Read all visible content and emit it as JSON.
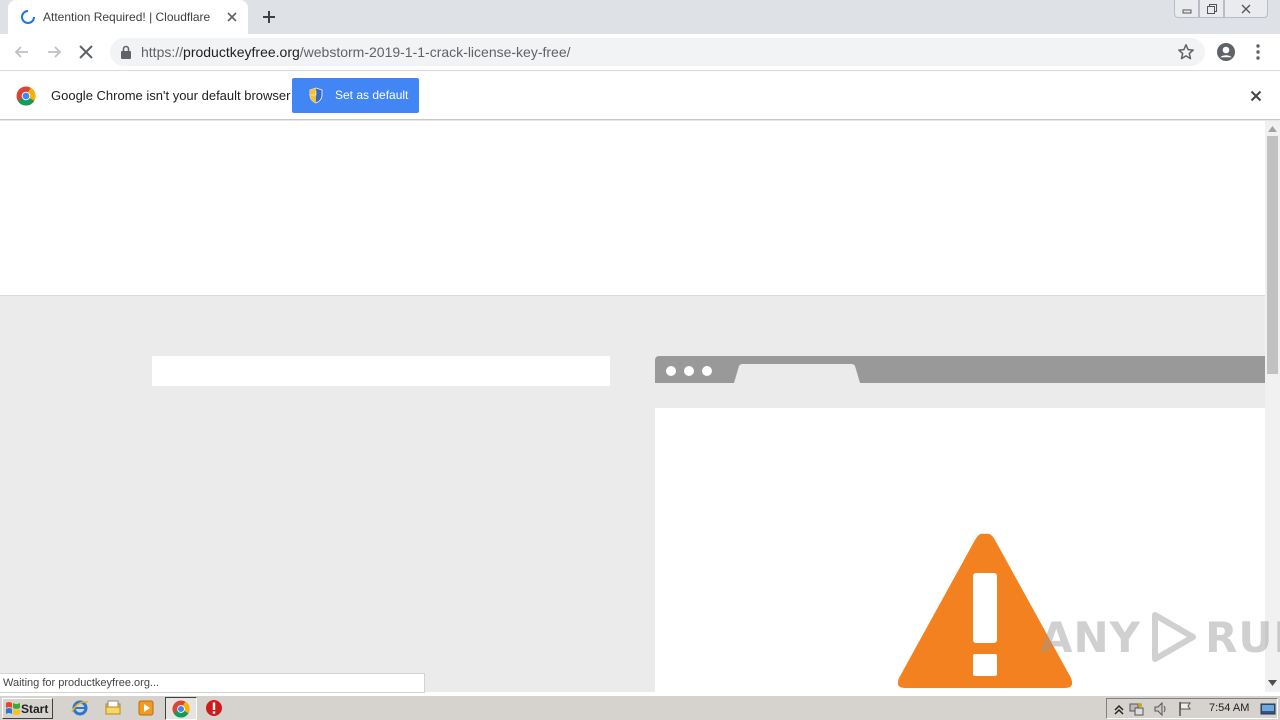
{
  "browser": {
    "tab": {
      "title": "Attention Required! | Cloudflare"
    },
    "new_tab_icon": "plus-icon",
    "window_controls": [
      "minimize-icon",
      "restore-icon",
      "close-icon"
    ]
  },
  "toolbar": {
    "url": {
      "protocol": "https://",
      "host": "productkeyfree.org",
      "path": "/webstorm-2019-1-1-crack-license-key-free/"
    }
  },
  "infobar": {
    "message": "Google Chrome isn't your default browser",
    "button_label": "Set as default"
  },
  "status_bubble": "Waiting for productkeyfree.org...",
  "watermark": {
    "left": "ANY",
    "right": "RUN"
  },
  "taskbar": {
    "start_label": "Start",
    "clock": "7:54 AM"
  },
  "colors": {
    "accent": "#4285f4",
    "warning": "#f48120",
    "page_bg": "#ebebeb"
  }
}
